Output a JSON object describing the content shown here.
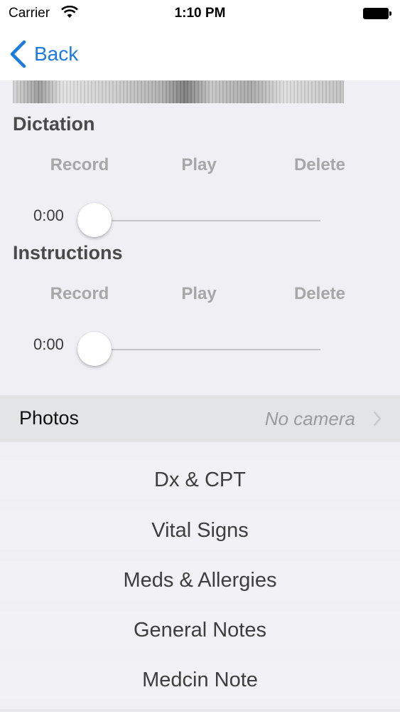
{
  "status_bar": {
    "carrier": "Carrier",
    "time": "1:10 PM"
  },
  "nav": {
    "back_label": "Back"
  },
  "dictation": {
    "title": "Dictation",
    "record": "Record",
    "play": "Play",
    "delete": "Delete",
    "time": "0:00",
    "progress": 0
  },
  "instructions": {
    "title": "Instructions",
    "record": "Record",
    "play": "Play",
    "delete": "Delete",
    "time": "0:00",
    "progress": 0
  },
  "photos": {
    "label": "Photos",
    "detail": "No camera"
  },
  "menu": [
    {
      "label": "Dx & CPT"
    },
    {
      "label": "Vital Signs"
    },
    {
      "label": "Meds & Allergies"
    },
    {
      "label": "General Notes"
    },
    {
      "label": "Medcin Note"
    }
  ],
  "colors": {
    "accent": "#1a7ce0",
    "disabled_text": "#a7a7a7",
    "background": "#efeff4"
  }
}
